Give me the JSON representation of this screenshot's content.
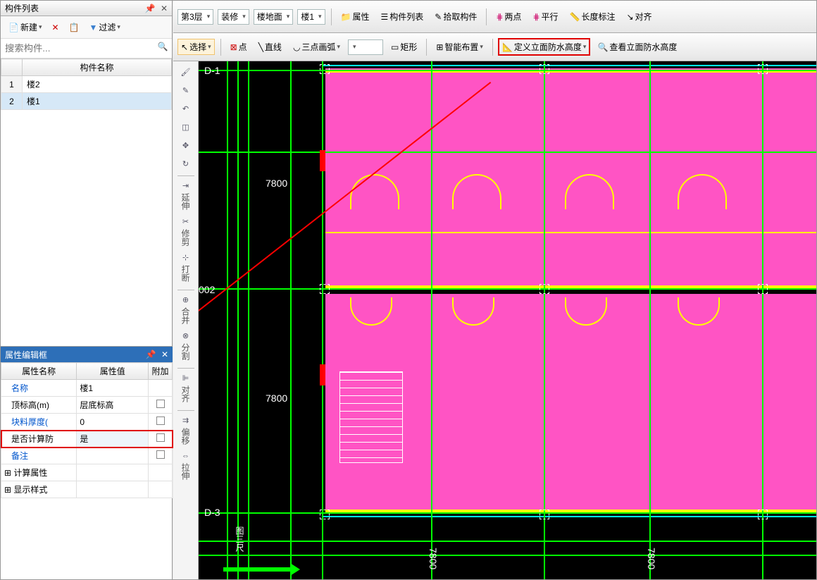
{
  "left": {
    "component_list_title": "构件列表",
    "new_btn": "新建",
    "filter_btn": "过滤",
    "search_placeholder": "搜索构件...",
    "grid_header": "构件名称",
    "rows": [
      {
        "idx": "1",
        "name": "楼2"
      },
      {
        "idx": "2",
        "name": "楼1"
      }
    ]
  },
  "prop": {
    "title": "属性编辑框",
    "col_name": "属性名称",
    "col_value": "属性值",
    "col_extra": "附加",
    "rows": {
      "name_k": "名称",
      "name_v": "楼1",
      "top_k": "顶标高(m)",
      "top_v": "层底标高",
      "thick_k": "块料厚度(",
      "thick_v": "0",
      "calc_k": "是否计算防",
      "calc_v": "是",
      "note_k": "备注",
      "group1": "计算属性",
      "group2": "显示样式"
    }
  },
  "top": {
    "floor": "第3层",
    "category": "装修",
    "subcat": "楼地面",
    "item": "楼1",
    "attr_btn": "属性",
    "complist_btn": "构件列表",
    "pick_btn": "拾取构件",
    "twopt": "两点",
    "parallel": "平行",
    "length": "长度标注",
    "align": "对齐"
  },
  "second": {
    "select": "选择",
    "point": "点",
    "line": "直线",
    "arc3": "三点画弧",
    "rect": "矩形",
    "smart": "智能布置",
    "def_height": "定义立面防水高度",
    "view_height": "查看立面防水高度"
  },
  "vtool": {
    "extend": "延伸",
    "trim": "修剪",
    "break": "打断",
    "merge": "合并",
    "split": "分割",
    "align": "对齐",
    "offset": "偏移",
    "stretch": "拉伸"
  },
  "cad": {
    "d1": "D-1",
    "d2": "002",
    "d3": "D-3",
    "dim1": "7800",
    "dim2": "7800",
    "dim3": "7800",
    "dim4": "7800",
    "lbl_fig": "图三尺"
  }
}
